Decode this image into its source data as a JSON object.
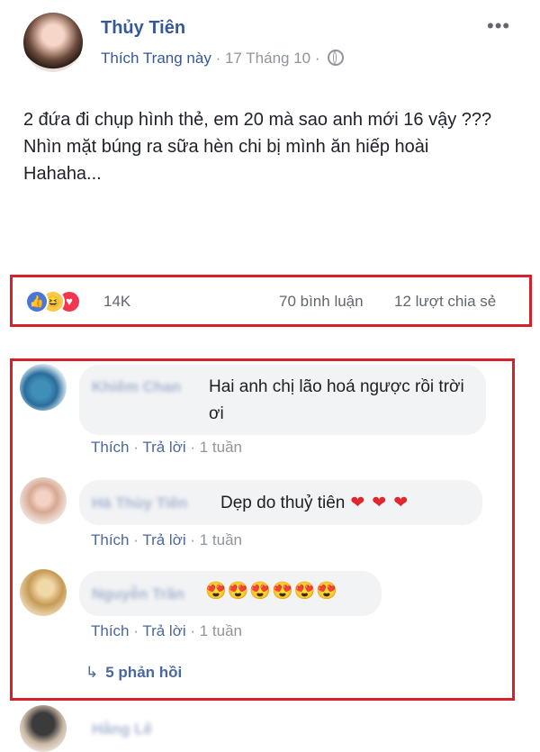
{
  "post": {
    "author": "Thủy Tiên",
    "like_page": "Thích Trang này",
    "meta_separator_1": " · ",
    "date": "17 Tháng 10",
    "meta_separator_2": " · ",
    "privacy_icon": "globe-icon",
    "more_icon": "•••",
    "text": "2 đứa đi chụp hình thẻ, em 20 mà sao anh mới 16 vậy ??? Nhìn mặt búng ra sữa hèn chi bị mình ăn hiếp hoài Hahaha..."
  },
  "reactions": {
    "icons": [
      "like-icon",
      "haha-icon",
      "love-icon"
    ],
    "like_glyph": "👍",
    "haha_glyph": "😆",
    "love_glyph": "♥",
    "count": "14K",
    "comments": "70 bình luận",
    "shares": "12 lượt chia sẻ"
  },
  "comments": [
    {
      "name": "Khiêm Chan",
      "text": "Hai anh chị lão hoá ngược rồi trời ơi",
      "like": "Thích",
      "reply": "Trả lời",
      "time": "1 tuần",
      "sep": " · "
    },
    {
      "name": "Hà Thùy Tiên",
      "text": "Dẹp do thuỷ tiên",
      "hearts": "❤❤❤",
      "like": "Thích",
      "reply": "Trả lời",
      "time": "1 tuần",
      "sep": " · "
    },
    {
      "name": "Nguyễn Trần",
      "text": "😍😍😍😍😍😍",
      "like": "Thích",
      "reply": "Trả lời",
      "time": "1 tuần",
      "sep": " · "
    }
  ],
  "replies": {
    "arrow": "↳",
    "label": "5 phản hồi"
  },
  "next_comment": {
    "name": "Hằng Lê"
  },
  "colors": {
    "link_blue": "#365899",
    "highlight_red": "#d6202a",
    "bubble_bg": "#f2f3f5",
    "meta_gray": "#90949c"
  }
}
